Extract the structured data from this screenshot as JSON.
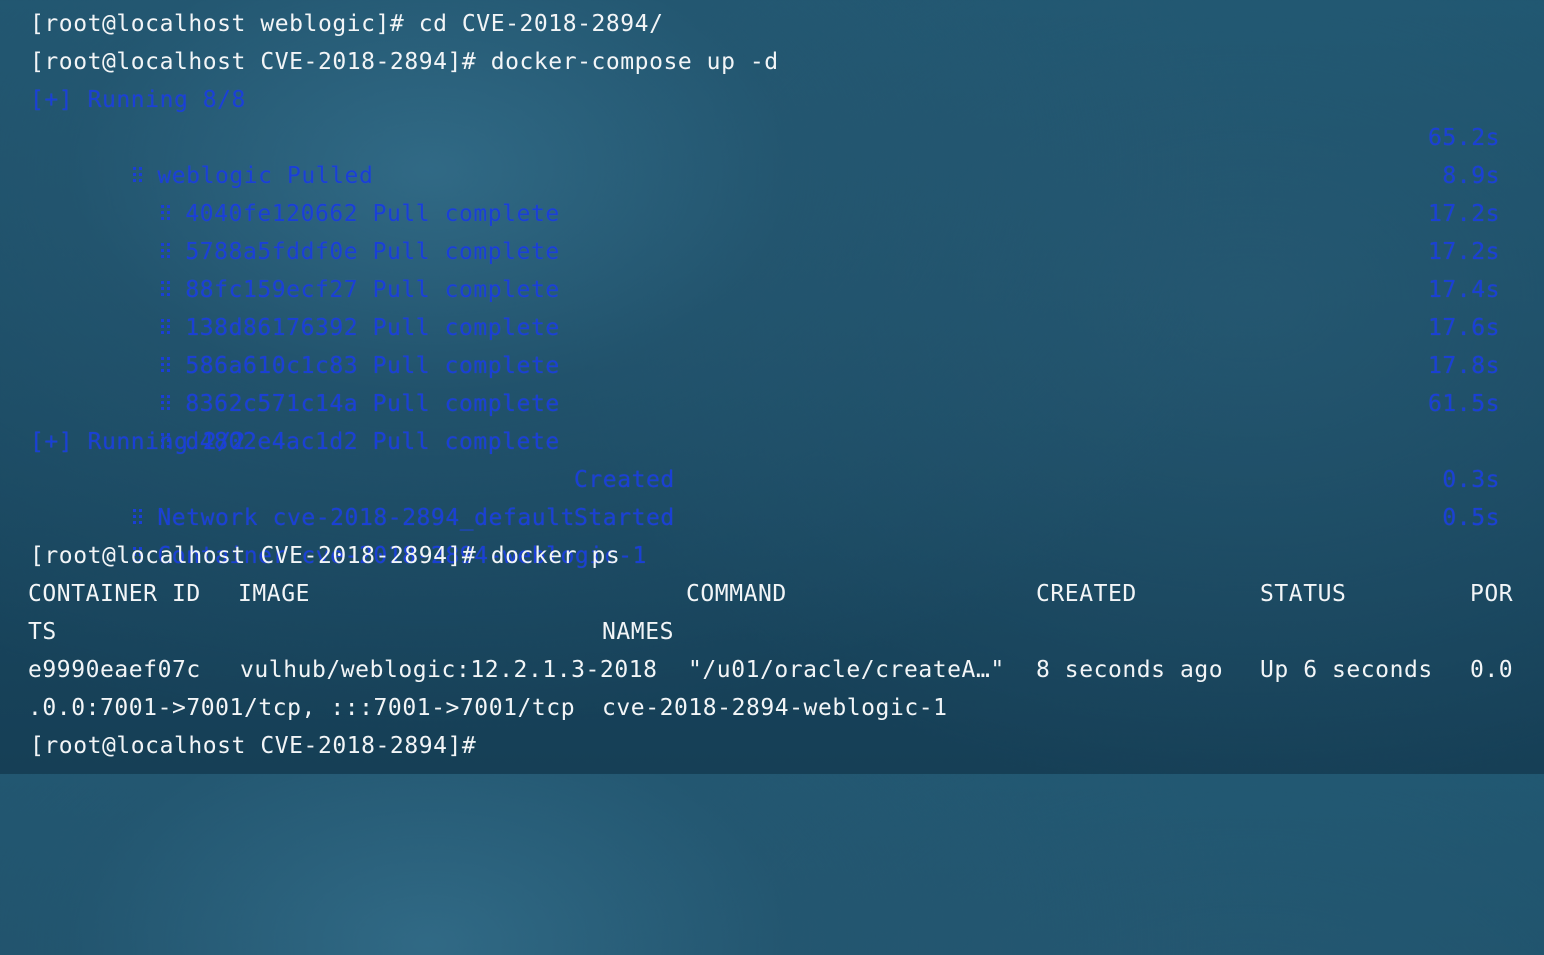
{
  "terminal": {
    "lines": {
      "l1": "[root@localhost weblogic]# cd CVE-2018-2894/",
      "l2": "[root@localhost CVE-2018-2894]# docker-compose up -d",
      "l3": "[+] Running 8/8",
      "l4_label": "weblogic Pulled",
      "l4_time": "65.2s",
      "layers": [
        {
          "id": "4040fe120662",
          "status": "Pull complete",
          "time": "8.9s"
        },
        {
          "id": "5788a5fddf0e",
          "status": "Pull complete",
          "time": "17.2s"
        },
        {
          "id": "88fc159ecf27",
          "status": "Pull complete",
          "time": "17.2s"
        },
        {
          "id": "138d86176392",
          "status": "Pull complete",
          "time": "17.4s"
        },
        {
          "id": "586a610c1c83",
          "status": "Pull complete",
          "time": "17.6s"
        },
        {
          "id": "8362c571c14a",
          "status": "Pull complete",
          "time": "17.8s"
        },
        {
          "id": "d4802e4ac1d2",
          "status": "Pull complete",
          "time": "61.5s"
        }
      ],
      "l12": "[+] Running 2/2",
      "network": {
        "label": "Network cve-2018-2894_default",
        "state": "Created",
        "time": "0.3s"
      },
      "container": {
        "label": "Container cve-2018-2894-weblogic-1",
        "state": "Started",
        "time": "0.5s"
      },
      "l15": "[root@localhost CVE-2018-2894]# docker ps",
      "ps_header": {
        "container_id": "CONTAINER ID",
        "image": "IMAGE",
        "command": "COMMAND",
        "created": "CREATED",
        "status": "STATUS",
        "ports_part1": "POR",
        "ports_part2": "TS",
        "names": "NAMES"
      },
      "ps_row": {
        "container_id": "e9990eaef07c",
        "image": "vulhub/weblogic:12.2.1.3-2018",
        "command": "\"/u01/oracle/createA…\"",
        "created": "8 seconds ago",
        "status": "Up 6 seconds",
        "ports_part1": "0.0",
        "ports_part2": ".0.0:7001->7001/tcp, :::7001->7001/tcp",
        "names": "cve-2018-2894-weblogic-1"
      },
      "l20": "[root@localhost CVE-2018-2894]#"
    }
  }
}
